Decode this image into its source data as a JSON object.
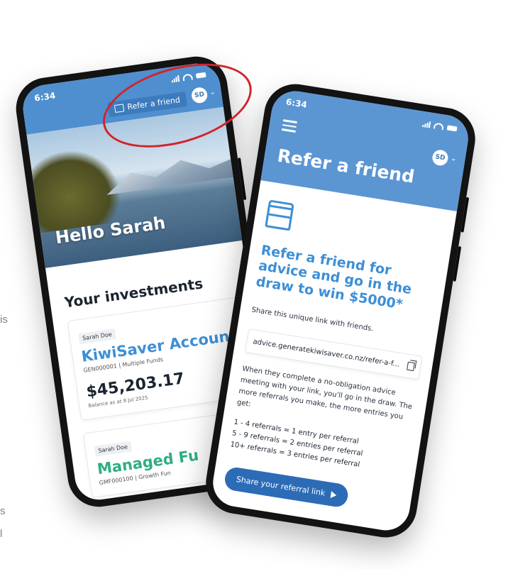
{
  "edge_texts": {
    "fragment_a": "is",
    "fragment_b": "s",
    "fragment_c": "l"
  },
  "phone1": {
    "status_time": "6:34",
    "refer_button_label": "Refer a friend",
    "avatar_initials": "SD",
    "greeting": "Hello Sarah",
    "section_title": "Your investments",
    "accounts": [
      {
        "owner": "Sarah Doe",
        "name": "KiwiSaver Account",
        "meta": "GEN000001 | Multiple Funds",
        "balance": "$45,203.17",
        "balance_date": "Balance as at 9 Jul 2025",
        "accent": "#3d8fd6"
      },
      {
        "owner": "Sarah Doe",
        "name": "Managed Fu",
        "meta": "GMF000100 | Growth Fun",
        "accent": "#2fae82"
      }
    ],
    "highlight_color": "#d2242a"
  },
  "phone2": {
    "status_time": "6:34",
    "avatar_initials": "SD",
    "page_title": "Refer a friend",
    "headline": "Refer a friend for advice and go in the draw to win $5000*",
    "share_intro": "Share this unique link with friends.",
    "referral_link": "advice.generatekiwisaver.co.nz/refer-a-f...",
    "description": "When they complete a no-obligation advice meeting with your link, you'll go in the draw. The more referrals you make, the more entries you get:",
    "tiers": [
      "1 - 4 referrals = 1 entry per referral",
      "5 - 9 referrals = 2 entries per referral",
      "10+ referrals = 3 entries per referral"
    ],
    "share_button_label": "Share your referral link",
    "header_color": "#5b96d3",
    "accent_color": "#3d8fd6",
    "button_color": "#2c6cb7"
  },
  "icons": [
    "signal-icon",
    "wifi-icon",
    "battery-icon",
    "gift-icon",
    "chevron-down-icon",
    "menu-icon",
    "copy-icon",
    "send-icon"
  ]
}
